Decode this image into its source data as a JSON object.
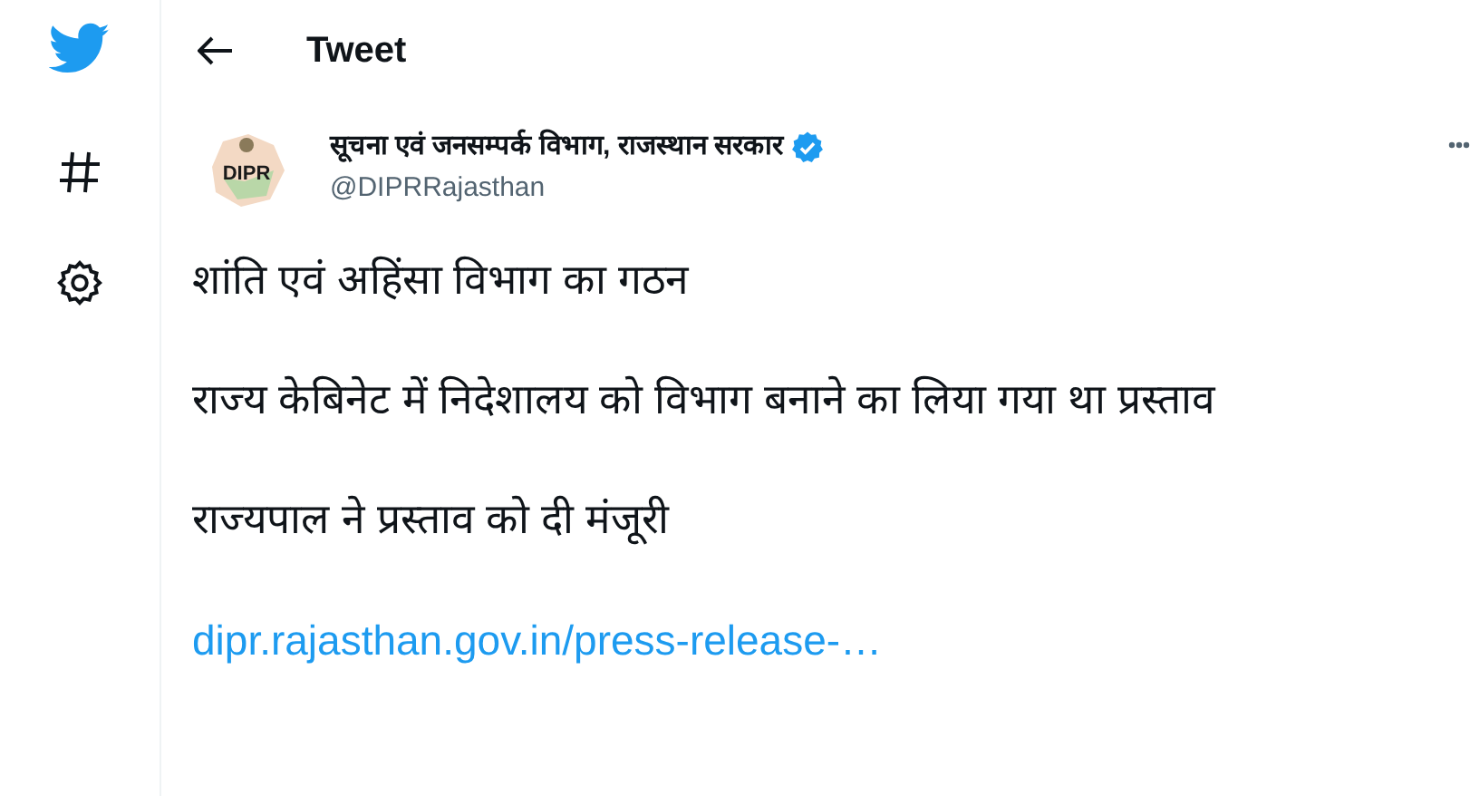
{
  "header": {
    "title": "Tweet"
  },
  "tweet": {
    "author": {
      "name": "सूचना एवं जनसम्पर्क विभाग, राजस्थान सरकार",
      "handle": "@DIPRRajasthan",
      "verified": true,
      "avatar_text": "DIPR"
    },
    "paragraphs": [
      "शांति एवं अहिंसा विभाग का गठन",
      "राज्य केबिनेट में निदेशालय को विभाग बनाने का लिया गया था प्रस्ताव",
      "राज्यपाल ने प्रस्ताव को दी मंजूरी"
    ],
    "link": "dipr.rajasthan.gov.in/press-release-…"
  }
}
